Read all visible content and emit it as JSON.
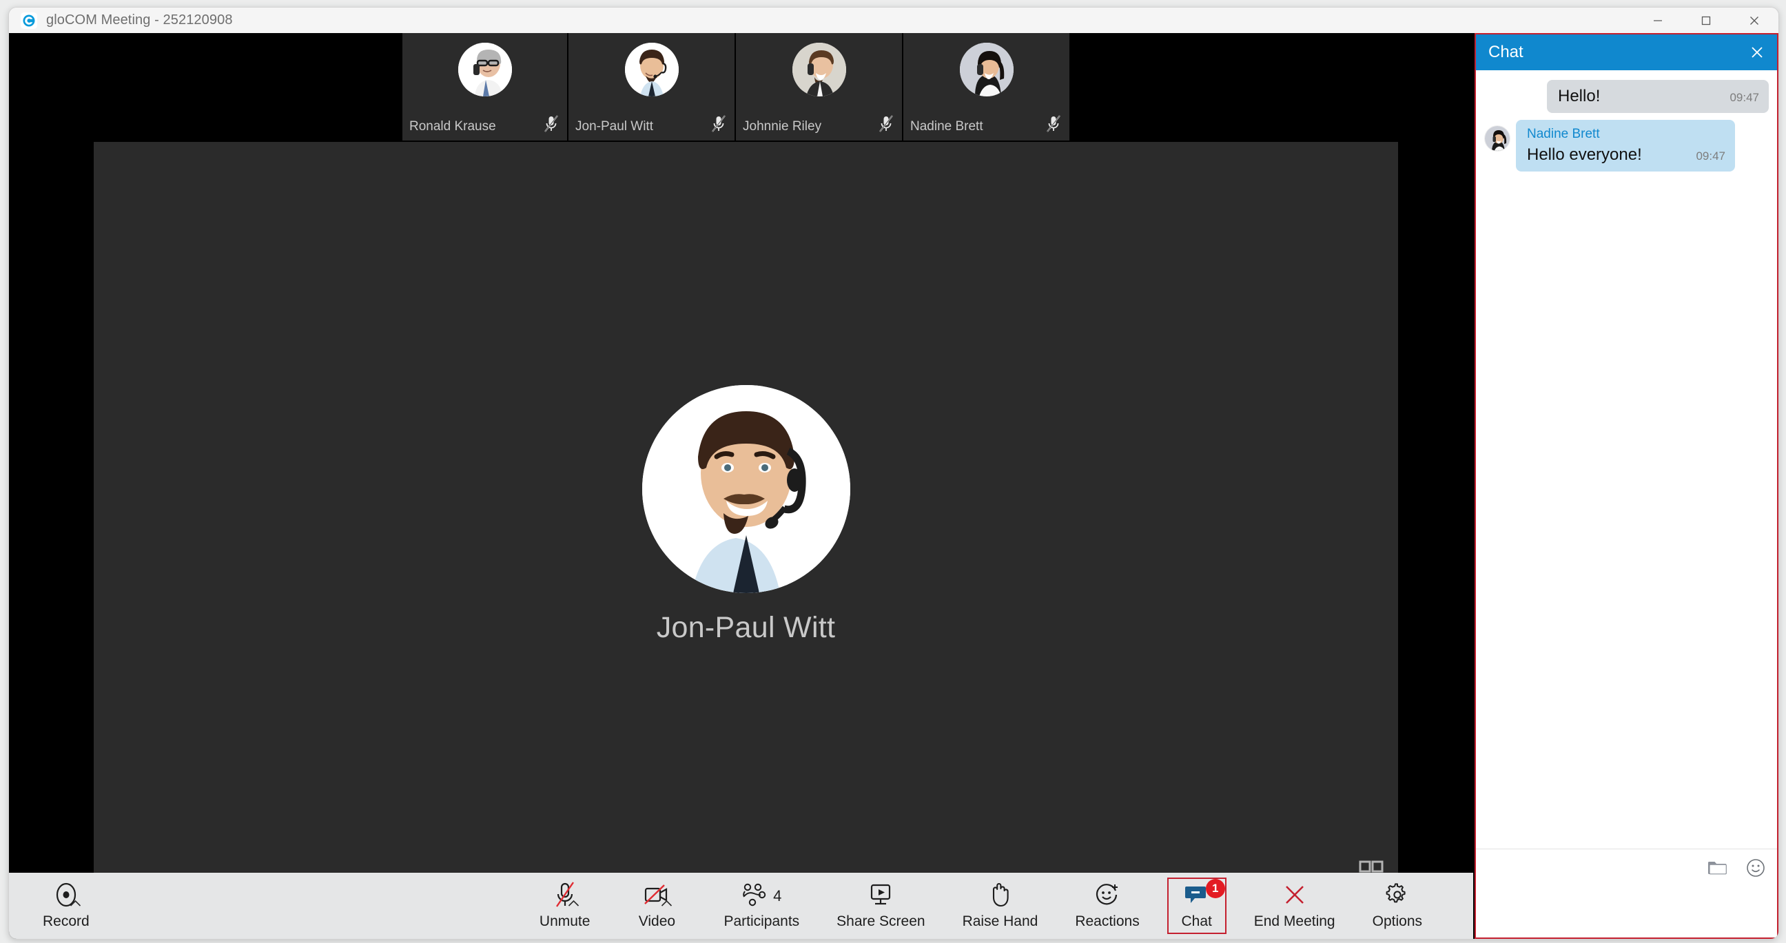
{
  "window": {
    "title": "gloCOM Meeting - 252120908",
    "logo_icon": "glocom-logo-icon",
    "minimize_label": "Minimize",
    "maximize_label": "Maximize",
    "close_label": "Close"
  },
  "thumbnails": [
    {
      "name": "Ronald Krause",
      "muted": true,
      "mute_icon": "mic-off-icon"
    },
    {
      "name": "Jon-Paul Witt",
      "muted": true,
      "mute_icon": "mic-off-icon"
    },
    {
      "name": "Johnnie Riley",
      "muted": true,
      "mute_icon": "mic-off-icon"
    },
    {
      "name": "Nadine Brett",
      "muted": true,
      "mute_icon": "mic-off-icon"
    }
  ],
  "stage": {
    "active_speaker": "Jon-Paul Witt",
    "grid_view_icon": "grid-view-icon"
  },
  "toolbar": {
    "items": [
      {
        "label": "Record",
        "icon": "record-icon",
        "caret": true,
        "count": null,
        "badge": null,
        "active": false
      },
      {
        "label": "Unmute",
        "icon": "mic-off-icon",
        "caret": true,
        "count": null,
        "badge": null,
        "active": false
      },
      {
        "label": "Video",
        "icon": "video-off-icon",
        "caret": true,
        "count": null,
        "badge": null,
        "active": false
      },
      {
        "label": "Participants",
        "icon": "participants-icon",
        "caret": false,
        "count": "4",
        "badge": null,
        "active": false
      },
      {
        "label": "Share Screen",
        "icon": "share-screen-icon",
        "caret": false,
        "count": null,
        "badge": null,
        "active": false
      },
      {
        "label": "Raise Hand",
        "icon": "raise-hand-icon",
        "caret": false,
        "count": null,
        "badge": null,
        "active": false
      },
      {
        "label": "Reactions",
        "icon": "reactions-icon",
        "caret": false,
        "count": null,
        "badge": null,
        "active": false
      },
      {
        "label": "Chat",
        "icon": "chat-bubble-icon",
        "caret": false,
        "count": null,
        "badge": "1",
        "active": true
      },
      {
        "label": "End Meeting",
        "icon": "end-meeting-icon",
        "caret": false,
        "count": null,
        "badge": null,
        "active": false
      },
      {
        "label": "Options",
        "icon": "gear-icon",
        "caret": false,
        "count": null,
        "badge": null,
        "active": false
      }
    ]
  },
  "chat": {
    "title": "Chat",
    "close_icon": "close-icon",
    "messages": [
      {
        "sender": null,
        "text": "Hello!",
        "time": "09:47",
        "outgoing": true
      },
      {
        "sender": "Nadine Brett",
        "text": "Hello everyone!",
        "time": "09:47",
        "outgoing": false
      }
    ],
    "input_placeholder": "",
    "input_value": "",
    "attach_icon": "folder-icon",
    "emoji_icon": "smiley-icon"
  },
  "colors": {
    "accent_blue": "#1088ce",
    "highlight_red": "#c4202f",
    "badge_red": "#e31b23",
    "stage_bg": "#2b2b2b",
    "toolbar_bg": "#e5e6e7"
  }
}
